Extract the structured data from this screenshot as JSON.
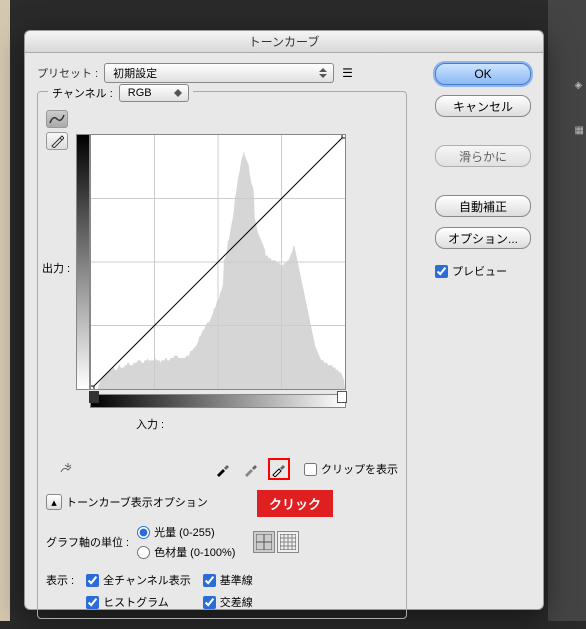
{
  "dialog": {
    "title": "トーンカーブ",
    "preset_label": "プリセット :",
    "preset_value": "初期設定",
    "channel_label": "チャンネル :",
    "channel_value": "RGB",
    "output_label": "出力 :",
    "input_label": "入力 :",
    "clip_label": "クリップを表示",
    "display_options": "トーンカーブ表示オプション",
    "axis_label": "グラフ軸の単位 :",
    "axis_light": "光量 (0-255)",
    "axis_pigment": "色材量 (0-100%)",
    "show_label": "表示 :",
    "check_all_channels": "全チャンネル表示",
    "check_histogram": "ヒストグラム",
    "check_baseline": "基準線",
    "check_intersection": "交差線"
  },
  "buttons": {
    "ok": "OK",
    "cancel": "キャンセル",
    "smooth": "滑らかに",
    "auto": "自動補正",
    "options": "オプション...",
    "preview": "プレビュー"
  },
  "callout": "クリック",
  "chart_data": {
    "type": "line",
    "title": "Tone Curve",
    "xlabel": "入力",
    "ylabel": "出力",
    "xlim": [
      0,
      255
    ],
    "ylim": [
      0,
      255
    ],
    "series": [
      {
        "name": "curve",
        "x": [
          0,
          255
        ],
        "y": [
          0,
          255
        ]
      }
    ],
    "histogram": [
      0,
      0,
      0,
      0,
      0,
      0,
      0,
      0,
      2,
      3,
      4,
      4,
      5,
      5,
      6,
      6,
      7,
      7,
      7,
      8,
      8,
      8,
      9,
      9,
      8,
      8,
      8,
      9,
      10,
      10,
      9,
      9,
      9,
      9,
      10,
      10,
      10,
      11,
      11,
      10,
      10,
      10,
      10,
      11,
      11,
      11,
      11,
      12,
      12,
      12,
      12,
      11,
      11,
      11,
      12,
      12,
      12,
      13,
      12,
      12,
      12,
      12,
      12,
      12,
      12,
      13,
      12,
      12,
      12,
      12,
      11,
      12,
      12,
      12,
      12,
      13,
      13,
      12,
      12,
      12,
      13,
      13,
      13,
      13,
      14,
      14,
      14,
      14,
      13,
      13,
      13,
      13,
      13,
      13,
      13,
      13,
      14,
      14,
      14,
      14,
      16,
      16,
      16,
      17,
      17,
      18,
      18,
      19,
      20,
      22,
      22,
      23,
      24,
      25,
      25,
      26,
      27,
      28,
      28,
      28,
      29,
      30,
      31,
      32,
      34,
      34,
      35,
      37,
      37,
      38,
      40,
      41,
      42,
      44,
      54,
      55,
      56,
      58,
      62,
      63,
      65,
      68,
      70,
      72,
      75,
      80,
      82,
      85,
      88,
      90,
      92,
      95,
      97,
      98,
      100,
      98,
      97,
      96,
      95,
      94,
      90,
      88,
      86,
      85,
      83,
      72,
      70,
      68,
      66,
      65,
      64,
      63,
      62,
      61,
      60,
      59,
      56,
      56,
      56,
      55,
      55,
      55,
      54,
      54,
      54,
      54,
      54,
      53,
      53,
      53,
      53,
      52,
      52,
      52,
      52,
      53,
      53,
      53,
      54,
      54,
      55,
      56,
      57,
      58,
      60,
      60,
      58,
      56,
      54,
      52,
      50,
      48,
      46,
      44,
      42,
      40,
      38,
      36,
      34,
      32,
      30,
      28,
      26,
      24,
      22,
      20,
      18,
      17,
      16,
      15,
      14,
      13,
      12,
      12,
      12,
      11,
      11,
      11,
      11,
      10,
      10,
      10,
      10,
      10,
      9,
      9,
      9,
      8,
      8,
      8,
      7,
      7,
      7,
      6,
      5,
      4
    ]
  }
}
